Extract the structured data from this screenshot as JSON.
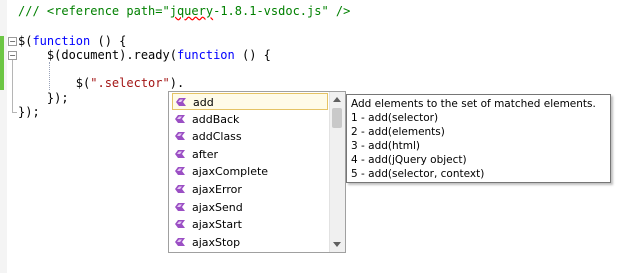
{
  "editor": {
    "lines": [
      {
        "parts": [
          {
            "t": "/// ",
            "c": "cmt"
          },
          {
            "t": "<reference path=\"",
            "c": "cmt"
          },
          {
            "t": "jquery",
            "c": "cmt squiggle"
          },
          {
            "t": "-1.8.1-vsdoc.js\" />",
            "c": "cmt"
          }
        ]
      },
      {
        "parts": []
      },
      {
        "parts": [
          {
            "t": "$(",
            "c": ""
          },
          {
            "t": "function",
            "c": "kw"
          },
          {
            "t": " () {",
            "c": ""
          }
        ]
      },
      {
        "parts": [
          {
            "t": "    $(document).ready(",
            "c": ""
          },
          {
            "t": "function",
            "c": "kw"
          },
          {
            "t": " () {",
            "c": ""
          }
        ]
      },
      {
        "parts": []
      },
      {
        "parts": [
          {
            "t": "        $(",
            "c": ""
          },
          {
            "t": "\".selector\"",
            "c": "str"
          },
          {
            "t": ").",
            "c": ""
          }
        ]
      },
      {
        "parts": [
          {
            "t": "    });",
            "c": ""
          }
        ]
      },
      {
        "parts": [
          {
            "t": "});",
            "c": ""
          }
        ]
      }
    ],
    "fold_markers": [
      "−",
      "−"
    ]
  },
  "completion": {
    "items": [
      "add",
      "addBack",
      "addClass",
      "after",
      "ajaxComplete",
      "ajaxError",
      "ajaxSend",
      "ajaxStart",
      "ajaxStop"
    ],
    "selected_index": 0,
    "icon_name": "method-icon",
    "icon_color": "#9b4fc4"
  },
  "tooltip": {
    "lines": [
      "Add elements to the set of matched elements.",
      "1 - add(selector)",
      "2 - add(elements)",
      "3 - add(html)",
      "4 - add(jQuery object)",
      "5 - add(selector, context)"
    ]
  },
  "colors": {
    "change_bar": "#6cc644",
    "comment": "#008000",
    "keyword": "#0000ff",
    "string": "#a31515"
  }
}
